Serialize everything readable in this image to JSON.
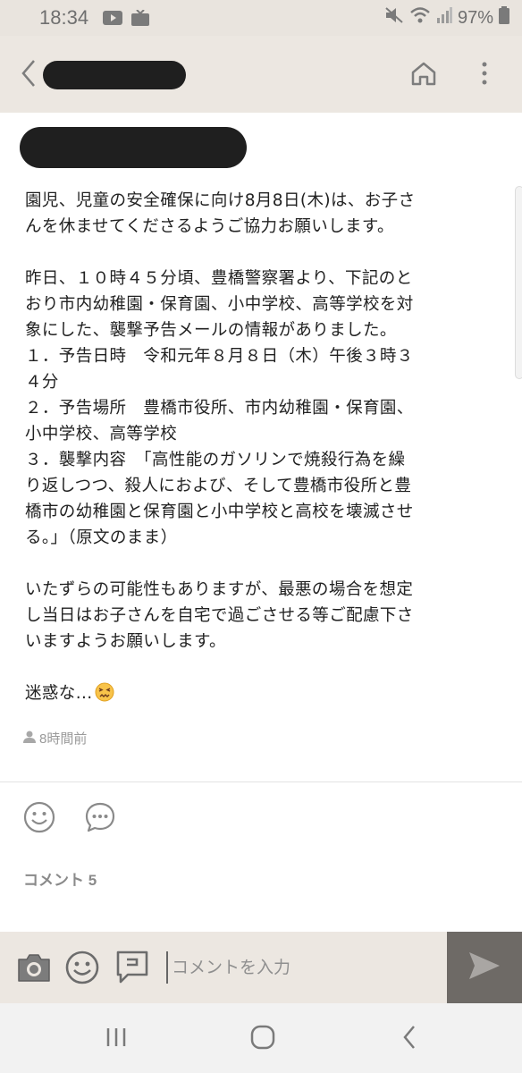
{
  "status_bar": {
    "time": "18:34",
    "battery": "97%",
    "icons": [
      "youtube-icon",
      "tv-icon",
      "mute-icon",
      "wifi-icon",
      "signal-icon",
      "battery-icon"
    ]
  },
  "header": {
    "back_icon": "chevron-left-icon",
    "home_icon": "home-icon",
    "more_icon": "more-vertical-icon"
  },
  "post": {
    "lines": [
      "園児、児童の安全確保に向け8月8日(木)は、お子さ",
      "んを休ませてくださるようご協力お願いします。",
      "",
      "昨日、１０時４５分頃、豊橋警察署より、下記のと",
      "おり市内幼稚園・保育園、小中学校、高等学校を対",
      "象にした、襲撃予告メールの情報がありました。",
      "１．予告日時　令和元年８月８日（木）午後３時３",
      "４分",
      "２．予告場所　豊橋市役所、市内幼稚園・保育園、",
      "小中学校、高等学校",
      "３．襲撃内容　「高性能のガソリンで焼殺行為を繰",
      "り返しつつ、殺人におよび、そして豊橋市役所と豊",
      "橋市の幼稚園と保育園と小中学校と高校を壊滅させ",
      "る。」（原文のまま）",
      "",
      "いたずらの可能性もありますが、最悪の場合を想定",
      "し当日はお子さんを自宅で過ごさせる等ご配慮下さ",
      "いますようお願いします。",
      ""
    ],
    "last_line": "迷惑な...",
    "emoji": "confounded-face-emoji",
    "meta_icon": "person-icon",
    "time_ago": "8時間前"
  },
  "reactions": {
    "smile_icon": "smiley-icon",
    "comment_icon": "speech-bubble-icon"
  },
  "comments": {
    "label": "コメント",
    "count": "5"
  },
  "comment_bar": {
    "placeholder": "コメントを入力",
    "camera_icon": "camera-icon",
    "sticker_icon": "smiley-icon",
    "stamp_icon": "stamp-icon",
    "send_icon": "send-icon"
  },
  "nav": {
    "recents_icon": "recents-icon",
    "home_icon": "home-circle-icon",
    "back_icon": "back-icon"
  },
  "colors": {
    "header_bg": "#ece7e1",
    "icon_gray": "#888888",
    "send_bg": "#6e6a66"
  }
}
